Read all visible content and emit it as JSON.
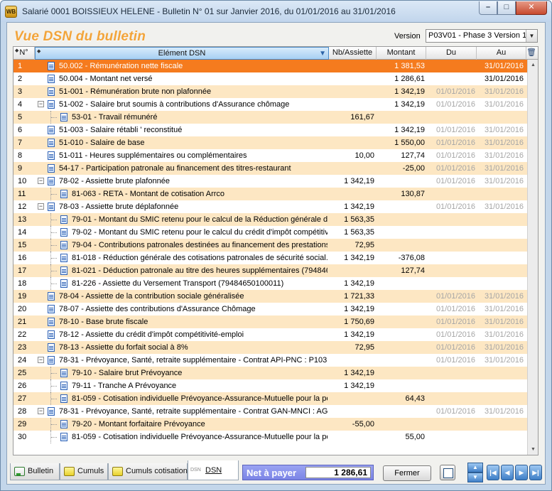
{
  "window": {
    "title": "Salarié 0001 BOISSIEUX HELENE - Bulletin N° 01 sur Janvier 2016, du 01/01/2016 au 31/01/2016",
    "app_icon": "WB",
    "minimize": "–",
    "maximize": "□",
    "close": "✕"
  },
  "page": {
    "title": "Vue DSN du bulletin",
    "version_label": "Version",
    "version_value": "P03V01 - Phase 3 Version 1"
  },
  "grid": {
    "columns": [
      "N°",
      "Elément DSN",
      "Nb/Assiette",
      "Montant",
      "Du",
      "Au"
    ],
    "rows": [
      {
        "n": "1",
        "level": 0,
        "code": "50.002",
        "label": "Rémunération nette fiscale",
        "nb": "",
        "montant": "1 381,53",
        "du": "",
        "au": "31/01/2016",
        "selected": true
      },
      {
        "n": "2",
        "level": 0,
        "code": "50.004",
        "label": "Montant net versé",
        "nb": "",
        "montant": "1 286,61",
        "du": "",
        "au": "31/01/2016"
      },
      {
        "n": "3",
        "level": 0,
        "code": "51-001",
        "label": "Rémunération brute non plafonnée",
        "nb": "",
        "montant": "1 342,19",
        "du": "01/01/2016",
        "au": "31/01/2016",
        "gray": true
      },
      {
        "n": "4",
        "level": 0,
        "toggle": "−",
        "code": "51-002",
        "label": "Salaire brut soumis à contributions d'Assurance chômage",
        "nb": "",
        "montant": "1 342,19",
        "du": "01/01/2016",
        "au": "31/01/2016",
        "gray": true
      },
      {
        "n": "5",
        "level": 1,
        "code": "53-01",
        "label": "Travail rémunéré",
        "nb": "161,67",
        "montant": "",
        "du": "",
        "au": ""
      },
      {
        "n": "6",
        "level": 0,
        "code": "51-003",
        "label": "Salaire rétabli ' reconstitué",
        "nb": "",
        "montant": "1 342,19",
        "du": "01/01/2016",
        "au": "31/01/2016",
        "gray": true
      },
      {
        "n": "7",
        "level": 0,
        "code": "51-010",
        "label": "Salaire de base",
        "nb": "",
        "montant": "1 550,00",
        "du": "01/01/2016",
        "au": "31/01/2016",
        "gray": true
      },
      {
        "n": "8",
        "level": 0,
        "code": "51-011",
        "label": "Heures supplémentaires ou complémentaires",
        "nb": "10,00",
        "montant": "127,74",
        "du": "01/01/2016",
        "au": "31/01/2016",
        "gray": true
      },
      {
        "n": "9",
        "level": 0,
        "code": "54-17",
        "label": "Participation patronale au financement des titres-restaurant",
        "nb": "",
        "montant": "-25,00",
        "du": "01/01/2016",
        "au": "31/01/2016",
        "gray": true
      },
      {
        "n": "10",
        "level": 0,
        "toggle": "−",
        "code": "78-02",
        "label": "Assiette  brute plafonnée",
        "nb": "1 342,19",
        "montant": "",
        "du": "01/01/2016",
        "au": "31/01/2016",
        "gray": true
      },
      {
        "n": "11",
        "level": 1,
        "code": "81-063",
        "label": "RETA - Montant de cotisation Arrco",
        "nb": "",
        "montant": "130,87",
        "du": "",
        "au": ""
      },
      {
        "n": "12",
        "level": 0,
        "toggle": "−",
        "code": "78-03",
        "label": "Assiette brute déplafonnée",
        "nb": "1 342,19",
        "montant": "",
        "du": "01/01/2016",
        "au": "31/01/2016",
        "gray": true
      },
      {
        "n": "13",
        "level": 1,
        "code": "79-01",
        "label": "Montant du SMIC retenu pour le calcul de la Réduction générale d...",
        "nb": "1 563,35",
        "montant": "",
        "du": "",
        "au": ""
      },
      {
        "n": "14",
        "level": 1,
        "code": "79-02",
        "label": "Montant du SMIC retenu pour le calcul du crédit d'impôt compétitiv...",
        "nb": "1 563,35",
        "montant": "",
        "du": "",
        "au": ""
      },
      {
        "n": "15",
        "level": 1,
        "code": "79-04",
        "label": "Contributions patronales destinées au financement des prestations ...",
        "nb": "72,95",
        "montant": "",
        "du": "",
        "au": ""
      },
      {
        "n": "16",
        "level": 1,
        "code": "81-018",
        "label": "Réduction générale des cotisations patronales de sécurité social...",
        "nb": "1 342,19",
        "montant": "-376,08",
        "du": "",
        "au": ""
      },
      {
        "n": "17",
        "level": 1,
        "code": "81-021",
        "label": "Déduction patronale au titre des heures supplémentaires (794846...",
        "nb": "",
        "montant": "127,74",
        "du": "",
        "au": ""
      },
      {
        "n": "18",
        "level": 1,
        "code": "81-226",
        "label": "Assiette du Versement Transport (79484650100011)",
        "nb": "1 342,19",
        "montant": "",
        "du": "",
        "au": ""
      },
      {
        "n": "19",
        "level": 0,
        "code": "78-04",
        "label": "Assiette de la contribution sociale généralisée",
        "nb": "1 721,33",
        "montant": "",
        "du": "01/01/2016",
        "au": "31/01/2016",
        "gray": true
      },
      {
        "n": "20",
        "level": 0,
        "code": "78-07",
        "label": "Assiette des contributions d'Assurance Chômage",
        "nb": "1 342,19",
        "montant": "",
        "du": "01/01/2016",
        "au": "31/01/2016",
        "gray": true
      },
      {
        "n": "21",
        "level": 0,
        "code": "78-10",
        "label": "Base brute fiscale",
        "nb": "1 750,69",
        "montant": "",
        "du": "01/01/2016",
        "au": "31/01/2016",
        "gray": true
      },
      {
        "n": "22",
        "level": 0,
        "code": "78-12",
        "label": "Assiette du crédit d'impôt compétitivité-emploi",
        "nb": "1 342,19",
        "montant": "",
        "du": "01/01/2016",
        "au": "31/01/2016",
        "gray": true
      },
      {
        "n": "23",
        "level": 0,
        "code": "78-13",
        "label": "Assiette du forfait social à 8%",
        "nb": "72,95",
        "montant": "",
        "du": "01/01/2016",
        "au": "31/01/2016",
        "gray": true
      },
      {
        "n": "24",
        "level": 0,
        "toggle": "−",
        "code": "78-31",
        "label": "Prévoyance, Santé, retraite supplémentaire - Contrat API-PNC : P103...",
        "nb": "",
        "montant": "",
        "du": "01/01/2016",
        "au": "31/01/2016",
        "gray": true
      },
      {
        "n": "25",
        "level": 1,
        "code": "79-10",
        "label": "Salaire brut Prévoyance",
        "nb": "1 342,19",
        "montant": "",
        "du": "",
        "au": ""
      },
      {
        "n": "26",
        "level": 1,
        "code": "79-11",
        "label": "Tranche A Prévoyance",
        "nb": "1 342,19",
        "montant": "",
        "du": "",
        "au": ""
      },
      {
        "n": "27",
        "level": 1,
        "code": "81-059",
        "label": "Cotisation individuelle Prévoyance-Assurance-Mutuelle pour la pé...",
        "nb": "",
        "montant": "64,43",
        "du": "",
        "au": ""
      },
      {
        "n": "28",
        "level": 0,
        "toggle": "−",
        "code": "78-31",
        "label": "Prévoyance, Santé, retraite supplémentaire - Contrat GAN-MNCI : AG...",
        "nb": "",
        "montant": "",
        "du": "01/01/2016",
        "au": "31/01/2016",
        "gray": true
      },
      {
        "n": "29",
        "level": 1,
        "code": "79-20",
        "label": "Montant forfaitaire Prévoyance",
        "nb": "-55,00",
        "montant": "",
        "du": "",
        "au": ""
      },
      {
        "n": "30",
        "level": 1,
        "code": "81-059",
        "label": "Cotisation individuelle Prévoyance-Assurance-Mutuelle pour la pé...",
        "nb": "",
        "montant": "55,00",
        "du": "",
        "au": ""
      }
    ]
  },
  "tabs": [
    {
      "label": "Bulletin",
      "icon": "green"
    },
    {
      "label": "Cumuls",
      "icon": "yellow"
    },
    {
      "label": "Cumuls cotisation",
      "icon": "yellow"
    },
    {
      "label": "DSN",
      "icon": "dsn",
      "active": true
    }
  ],
  "dsn_icon_text": "DSN",
  "footer": {
    "net_label": "Net à payer",
    "net_value": "1 286,61",
    "close_label": "Fermer"
  },
  "nav": {
    "up": "▲",
    "down": "▼",
    "first": "|◀",
    "prev": "◀",
    "next": "▶",
    "last": "▶|"
  },
  "colors": {
    "selected_row": "#f57b1e",
    "alt_row": "#fde7c3",
    "title_orange": "#f2a43a"
  }
}
